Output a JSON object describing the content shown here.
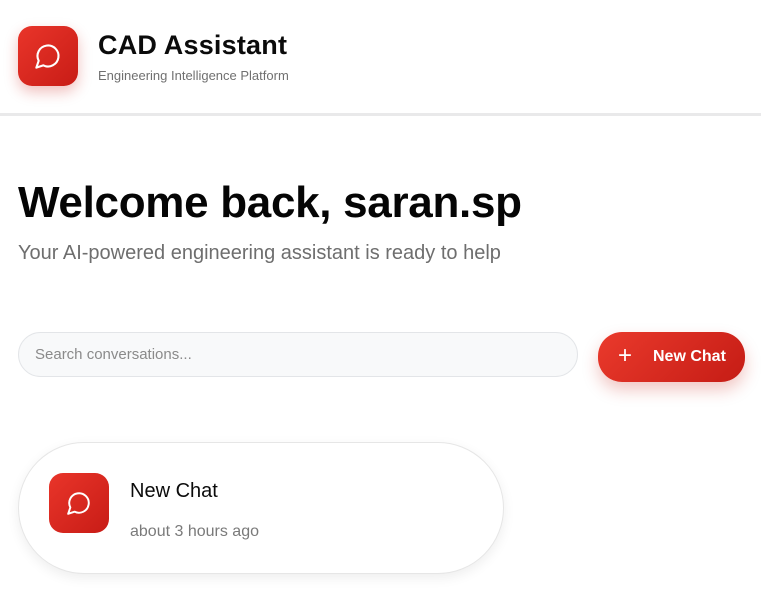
{
  "header": {
    "title": "CAD Assistant",
    "subtitle": "Engineering Intelligence Platform",
    "logo_icon": "chat-bubble-icon"
  },
  "welcome": {
    "title": "Welcome back, saran.sp",
    "subtitle": "Your AI-powered engineering assistant is ready to help"
  },
  "search": {
    "placeholder": "Search conversations...",
    "value": ""
  },
  "new_chat_button": {
    "icon": "plus-icon",
    "label": "New Chat"
  },
  "conversations": [
    {
      "title": "New Chat",
      "time": "about 3 hours ago",
      "icon": "chat-bubble-icon"
    }
  ],
  "colors": {
    "accent": "#dc2a20",
    "accent_dark": "#c51c15",
    "text_primary": "#0b0b0b",
    "text_secondary": "#707070",
    "search_bg": "#f8f9fa"
  }
}
